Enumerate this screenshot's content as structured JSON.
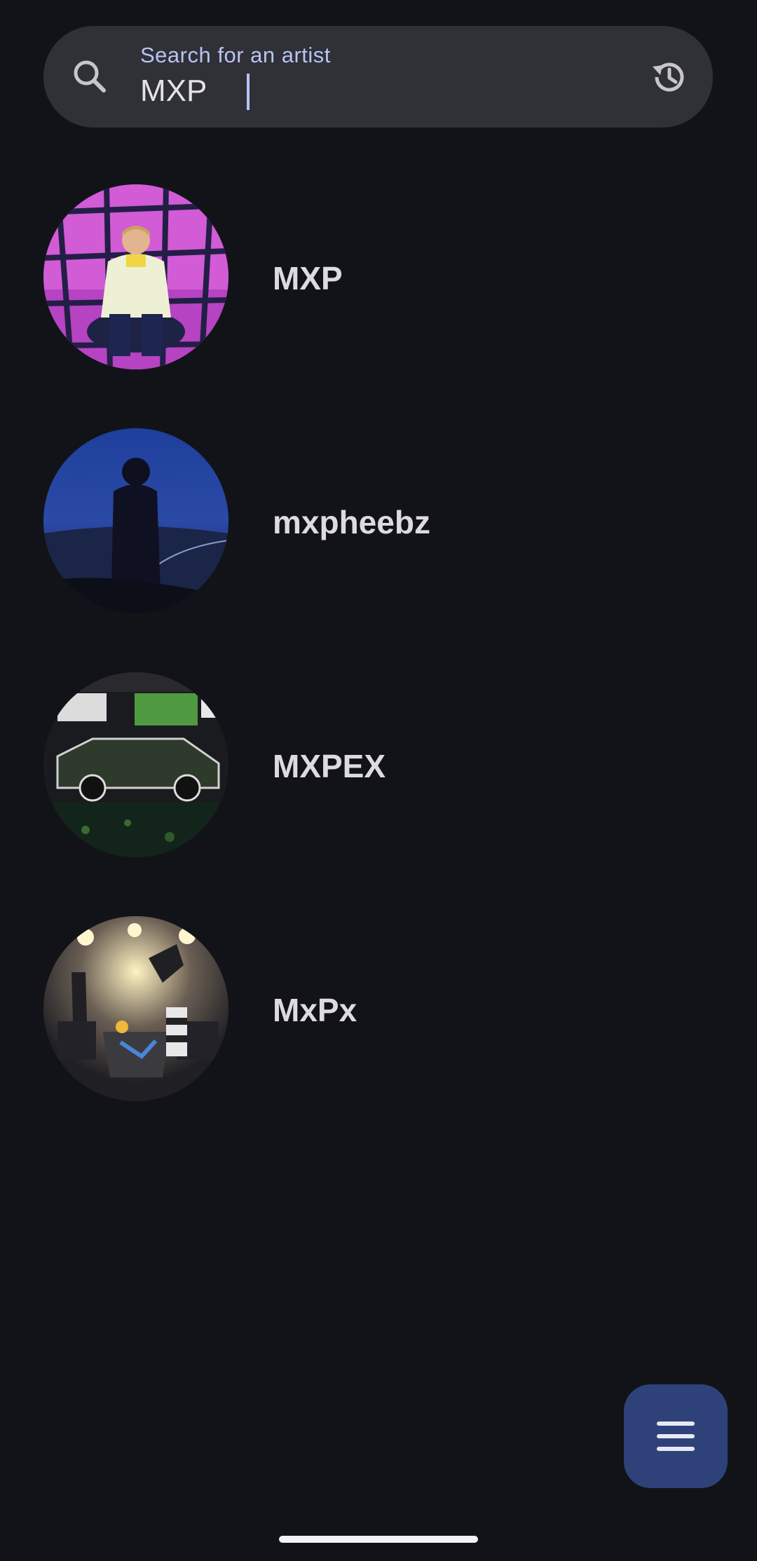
{
  "search": {
    "label": "Search for an artist",
    "value": "MXP",
    "left_icon": "search-icon",
    "right_icon": "history-icon"
  },
  "results": [
    {
      "name": "MXP",
      "avatar": "artist-photo-pink-stage"
    },
    {
      "name": "mxpheebz",
      "avatar": "artist-photo-night-silhouette"
    },
    {
      "name": "MXPEX",
      "avatar": "artist-photo-car-collage"
    },
    {
      "name": "MxPx",
      "avatar": "artist-photo-concert-stage"
    }
  ],
  "fab": {
    "icon": "menu-icon"
  },
  "colors": {
    "background": "#121318",
    "search_bar": "#2f3136",
    "accent": "#b7c3f6",
    "fab": "#2e4279",
    "text": "#dcdbe1"
  }
}
